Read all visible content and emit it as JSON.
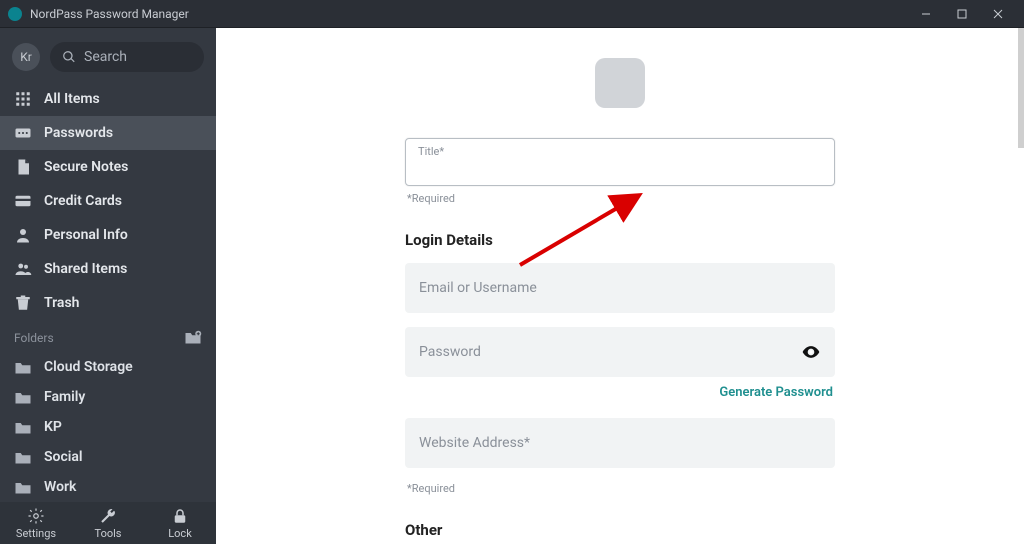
{
  "window": {
    "title": "NordPass Password Manager"
  },
  "sidebar": {
    "avatar_initials": "Kr",
    "search_placeholder": "Search",
    "items": [
      {
        "label": "All Items",
        "icon": "grid-icon"
      },
      {
        "label": "Passwords",
        "icon": "password-icon",
        "active": true
      },
      {
        "label": "Secure Notes",
        "icon": "note-icon"
      },
      {
        "label": "Credit Cards",
        "icon": "card-icon"
      },
      {
        "label": "Personal Info",
        "icon": "person-icon"
      },
      {
        "label": "Shared Items",
        "icon": "people-icon"
      },
      {
        "label": "Trash",
        "icon": "trash-icon"
      }
    ],
    "folders_header": "Folders",
    "folders": [
      {
        "label": "Cloud Storage"
      },
      {
        "label": "Family"
      },
      {
        "label": "KP"
      },
      {
        "label": "Social"
      },
      {
        "label": "Work"
      }
    ],
    "footer": {
      "settings": "Settings",
      "tools": "Tools",
      "lock": "Lock"
    }
  },
  "form": {
    "title_label": "Title*",
    "title_value": "",
    "required_hint": "*Required",
    "section_login": "Login Details",
    "email_placeholder": "Email or Username",
    "password_placeholder": "Password",
    "generate_password": "Generate Password",
    "website_placeholder": "Website Address*",
    "section_other": "Other"
  },
  "annotation": {
    "color": "#d90000",
    "points_to": "title-field"
  }
}
